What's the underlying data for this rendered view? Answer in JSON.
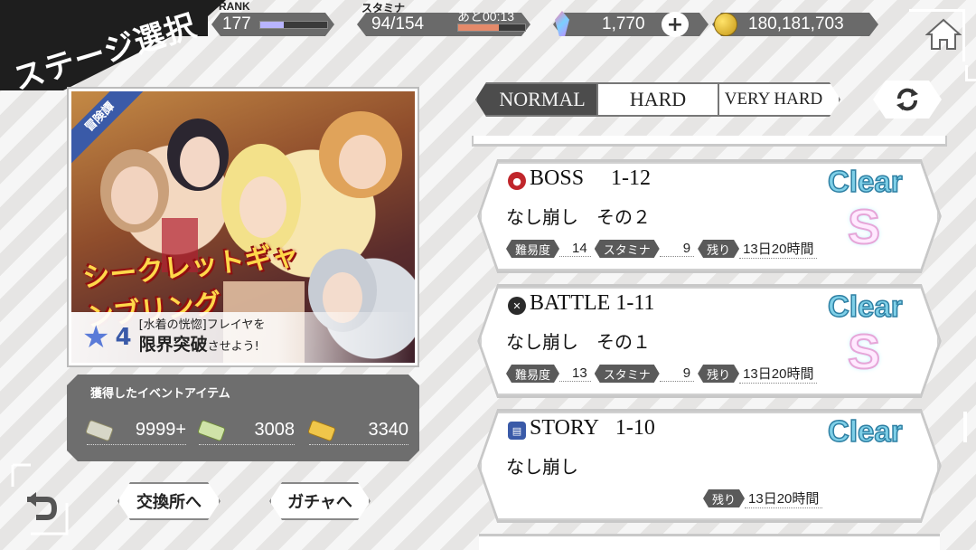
{
  "header": {
    "title": "ステージ選択",
    "rank_label": "RANK",
    "rank_value": "177",
    "rank_progress": 0.35,
    "stamina_label": "スタミナ",
    "stamina_value": "94/154",
    "stamina_timer": "あと00:13",
    "stamina_progress": 0.61,
    "crystals": "1,770",
    "gold": "180,181,703"
  },
  "banner": {
    "tag": "冒険譚",
    "logo_text": "シークレットギャンブリング",
    "caption_star": "4",
    "caption_line1": "[水着の恍惚]フレイヤを",
    "caption_line2_big": "限界突破",
    "caption_line2_small": "させよう!"
  },
  "event_items": {
    "title": "獲得したイベントアイテム",
    "items": [
      {
        "icon": "scroll-icon-grey",
        "value": "9999+"
      },
      {
        "icon": "scroll-icon-green",
        "value": "3008"
      },
      {
        "icon": "scroll-icon-gold",
        "value": "3340"
      }
    ]
  },
  "buttons": {
    "exchange": "交換所へ",
    "gacha": "ガチャへ"
  },
  "tabs": [
    {
      "label": "NORMAL",
      "active": true
    },
    {
      "label": "HARD",
      "active": false
    },
    {
      "label": "VERY HARD",
      "active": false
    }
  ],
  "stages": [
    {
      "type": "BOSS",
      "number": "1-12",
      "name": "なし崩し　その２",
      "difficulty_label": "難易度",
      "difficulty": "14",
      "stamina_label": "スタミナ",
      "stamina": "9",
      "remain_label": "残り",
      "remain": "13日20時間",
      "clear": "Clear",
      "rank": "S",
      "icon_color": "#c0262b"
    },
    {
      "type": "BATTLE",
      "number": "1-11",
      "name": "なし崩し　その１",
      "difficulty_label": "難易度",
      "difficulty": "13",
      "stamina_label": "スタミナ",
      "stamina": "9",
      "remain_label": "残り",
      "remain": "13日20時間",
      "clear": "Clear",
      "rank": "S",
      "icon_color": "#2b2b2b"
    },
    {
      "type": "STORY",
      "number": "1-10",
      "name": "なし崩し",
      "remain_label": "残り",
      "remain": "13日20時間",
      "clear": "Clear",
      "icon_color": "#3a5aa8"
    }
  ],
  "colors": {
    "rank_bar": "#b8b4ff",
    "stamina_bar": "#e58a6a",
    "clear_text": "#7fd0e8",
    "dark_grey": "#5a5a5a"
  }
}
